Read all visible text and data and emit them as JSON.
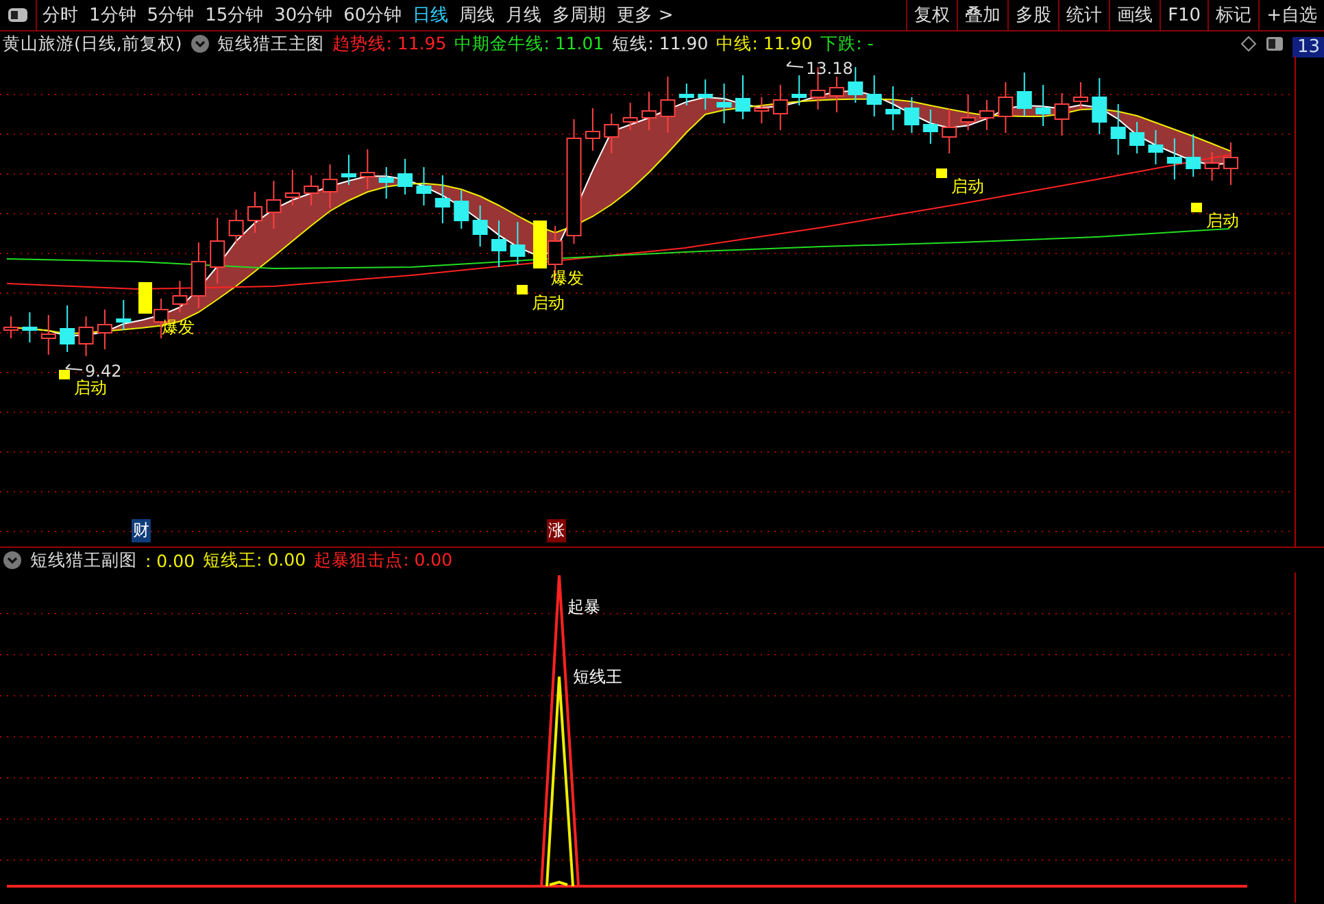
{
  "toolbar": {
    "periods": [
      {
        "label": "分时",
        "selected": false
      },
      {
        "label": "1分钟",
        "selected": false
      },
      {
        "label": "5分钟",
        "selected": false
      },
      {
        "label": "15分钟",
        "selected": false
      },
      {
        "label": "30分钟",
        "selected": false
      },
      {
        "label": "60分钟",
        "selected": false
      },
      {
        "label": "日线",
        "selected": true
      },
      {
        "label": "周线",
        "selected": false
      },
      {
        "label": "月线",
        "selected": false
      },
      {
        "label": "多周期",
        "selected": false
      },
      {
        "label": "更多 >",
        "selected": false
      }
    ],
    "buttons": [
      "复权",
      "叠加",
      "多股",
      "统计",
      "画线",
      "F10",
      "标记",
      "+自选"
    ]
  },
  "main_header": {
    "stock": "黄山旅游(日线,前复权)",
    "indicator": "短线猎王主图",
    "values": [
      {
        "text": "趋势线: 11.95",
        "color": "#ff2020"
      },
      {
        "text": "中期金牛线: 11.01",
        "color": "#20e020"
      },
      {
        "text": "短线: 11.90",
        "color": "#e0e0e0"
      },
      {
        "text": "中线: 11.90",
        "color": "#f0f000"
      },
      {
        "text": "下跌: -",
        "color": "#20e020"
      }
    ]
  },
  "side_badge": "13",
  "main_chart": {
    "annotations": [
      {
        "kind": "high",
        "text": "13.18"
      },
      {
        "kind": "low",
        "text": "9.42"
      },
      {
        "kind": "signal",
        "text": "爆发"
      },
      {
        "kind": "signal",
        "text": "启动"
      },
      {
        "kind": "signal",
        "text": "爆发"
      },
      {
        "kind": "signal",
        "text": "启动"
      },
      {
        "kind": "signal",
        "text": "启动"
      },
      {
        "kind": "signal",
        "text": "启动"
      }
    ],
    "markers": [
      {
        "text": "财",
        "color": "#103c7c"
      },
      {
        "text": "涨",
        "color": "#800000"
      }
    ]
  },
  "sub_header": {
    "indicator": "短线猎王副图",
    "values": [
      {
        "text": ": 0.00",
        "color": "#f0f000"
      },
      {
        "text": "短线王: 0.00",
        "color": "#f0f000"
      },
      {
        "text": "起暴狙击点: 0.00",
        "color": "#ff2020"
      }
    ]
  },
  "sub_chart": {
    "labels": [
      "起暴",
      "短线王"
    ]
  }
}
